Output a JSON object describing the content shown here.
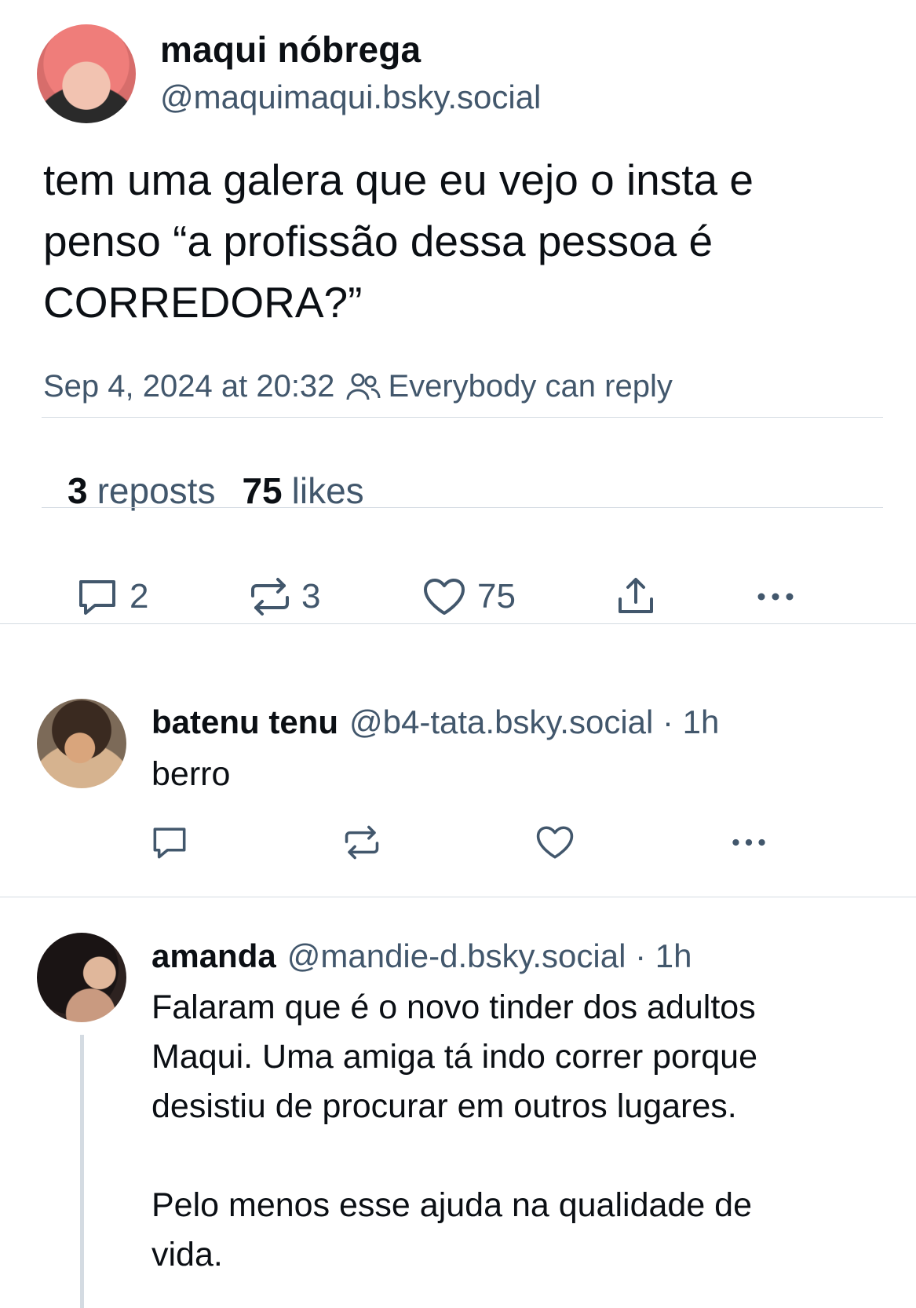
{
  "post": {
    "author": {
      "display_name": "maqui nóbrega",
      "handle": "@maquimaqui.bsky.social",
      "avatar": "avatar"
    },
    "text": "tem uma galera que eu vejo o insta e\npenso “a profissão dessa pessoa é\nCORREDORA?”",
    "timestamp": "Sep 4, 2024 at 20:32",
    "reply_setting": "Everybody can reply",
    "reply_setting_icon": "people-icon",
    "stats": {
      "reposts_count": "3",
      "reposts_label": "reposts",
      "likes_count": "75",
      "likes_label": "likes"
    },
    "actions": {
      "reply_count": "2",
      "repost_count": "3",
      "like_count": "75"
    }
  },
  "replies": [
    {
      "display_name": "batenu tenu",
      "meta": "@b4-tata.bsky.social · 1h",
      "text": "berro"
    },
    {
      "display_name": "amanda",
      "meta": "@mandie-d.bsky.social · 1h",
      "text": "Falaram que é o novo tinder dos adultos\nMaqui. Uma amiga tá indo correr porque\ndesistiu de procurar em outros lugares.\n\nPelo menos esse ajuda na qualidade de\nvida."
    }
  ],
  "colors": {
    "text": "#0b0f14",
    "secondary": "#42576c",
    "divider": "#d4dbe2"
  }
}
